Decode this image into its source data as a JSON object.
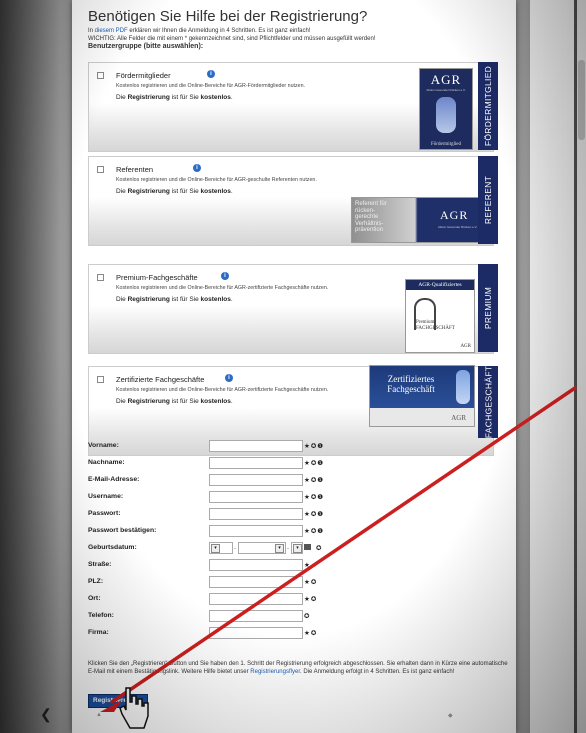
{
  "page": {
    "title": "Benötigen Sie Hilfe bei der Registrierung?",
    "intro_prefix": "In ",
    "intro_link": "diesem PDF",
    "intro_suffix": " erklären wir Ihnen die Anmeldung in 4 Schritten. Es ist ganz einfach!",
    "intro_warning": "WICHTIG: Alle Felder die mit einem * gekennzeichnet sind, sind Pflichtfelder und müssen ausgefüllt werden!",
    "group_heading": "Benutzergruppe (bitte auswählen):"
  },
  "groups": [
    {
      "title": "Fördermitglieder",
      "desc": "Kostenlos registrieren und die Online-Bereiche für AGR-Fördermitglieder nutzen.",
      "free_pre": "Die ",
      "free_bold1": "Registrierung",
      "free_mid": " ist für Sie ",
      "free_bold2": "kostenlos",
      "free_end": ".",
      "tab": "FÖRDERMITGLIED",
      "badge_top": "AGR",
      "badge_sub": "Aktion Gesunder Rücken e.V.",
      "badge_bottom": "Fördermitglied"
    },
    {
      "title": "Referenten",
      "desc": "Kostenlos registrieren und die Online-Bereiche für AGR-geschulte Referenten nutzen.",
      "free_pre": "Die ",
      "free_bold1": "Registrierung",
      "free_mid": " ist für Sie ",
      "free_bold2": "kostenlos",
      "free_end": ".",
      "tab": "REFERENT",
      "badge_text": "Referent für rücken-gerechte Verhältnis-prävention",
      "badge_top": "AGR",
      "badge_sub": "Aktion Gesunder Rücken e.V."
    },
    {
      "title": "Premium-Fachgeschäfte",
      "desc": "Kostenlos registrieren und die Online-Bereiche für AGR-zertifizierte Fachgeschäfte nutzen.",
      "free_pre": "Die ",
      "free_bold1": "Registrierung",
      "free_mid": " ist für Sie ",
      "free_bold2": "kostenlos",
      "free_end": ".",
      "tab": "PREMIUM",
      "badge_top": "AGR-Qualifiziertes",
      "badge_mid": "Premium",
      "badge_bottom": "FACHGESCHÄFT",
      "badge_foot": "AGR"
    },
    {
      "title": "Zertifizierte Fachgeschäfte",
      "desc": "Kostenlos registrieren und die Online-Bereiche für AGR-zertifizierte Fachgeschäfte nutzen.",
      "free_pre": "Die ",
      "free_bold1": "Registrierung",
      "free_mid": " ist für Sie ",
      "free_bold2": "kostenlos",
      "free_end": ".",
      "tab": "FACHGESCHÄFT",
      "badge_top": "Zertifiziertes",
      "badge_mid": "Fachgeschäft",
      "badge_foot": "AGR"
    }
  ],
  "form": {
    "fields": [
      {
        "label": "Vorname:",
        "marks": "★✪❶"
      },
      {
        "label": "Nachname:",
        "marks": "★✪❶"
      },
      {
        "label": "E-Mail-Adresse:",
        "marks": "★✪❶"
      },
      {
        "label": "Username:",
        "marks": "★✪❶"
      },
      {
        "label": "Passwort:",
        "marks": "★✪❶"
      },
      {
        "label": "Passwort bestätigen:",
        "marks": "★✪❶"
      },
      {
        "label": "Geburtsdatum:",
        "marks": "✪"
      },
      {
        "label": "Straße:",
        "marks": "★"
      },
      {
        "label": "PLZ:",
        "marks": "★✪"
      },
      {
        "label": "Ort:",
        "marks": "★✪"
      },
      {
        "label": "Telefon:",
        "marks": "✪"
      },
      {
        "label": "Firma:",
        "marks": "★✪"
      }
    ],
    "date_sep": "."
  },
  "note": {
    "text1": "Klicken Sie den „Registrieren“-Button und Sie haben den 1. Schritt der Registrierung erfolgreich abgeschlossen. Sie erhalten dann in Kürze eine automatische E-Mail mit einem Bestätigungslink. Weitere Hilfe bietet unser ",
    "link": "Registrierungsflyer",
    "text2": ". Die Anmeldung erfolgt in 4 Schritten. Es ist ganz einfach!"
  },
  "button": {
    "label": "Registrieren"
  },
  "colors": {
    "tab": "#1c2a66",
    "link": "#1a5fb4",
    "arrow": "#cc1f1f",
    "button": "#1b4fa0"
  }
}
